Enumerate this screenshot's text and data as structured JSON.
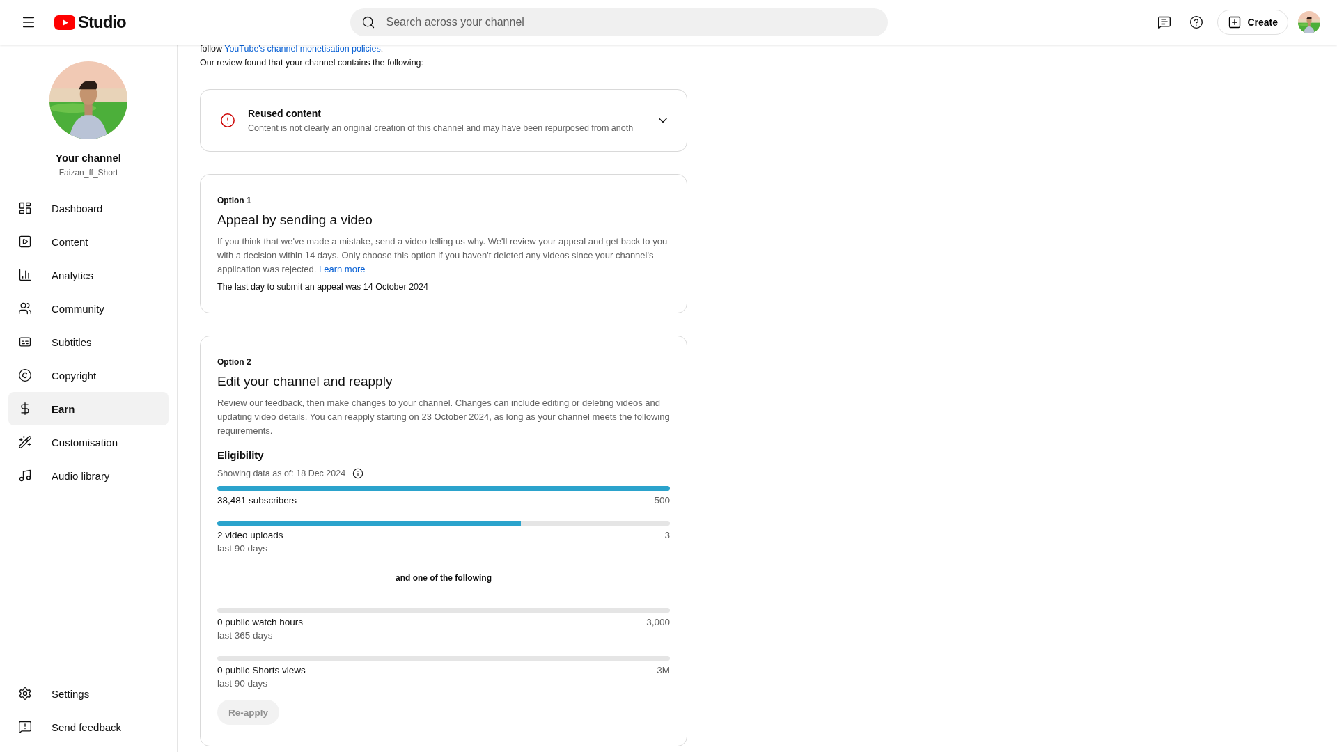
{
  "header": {
    "logo_text": "Studio",
    "search": {
      "placeholder": "Search across your channel"
    },
    "create_label": "Create"
  },
  "sidebar": {
    "channel_title": "Your channel",
    "channel_handle": "Faizan_ff_Short",
    "items": [
      {
        "label": "Dashboard",
        "selected": false
      },
      {
        "label": "Content",
        "selected": false
      },
      {
        "label": "Analytics",
        "selected": false
      },
      {
        "label": "Community",
        "selected": false
      },
      {
        "label": "Subtitles",
        "selected": false
      },
      {
        "label": "Copyright",
        "selected": false
      },
      {
        "label": "Earn",
        "selected": true
      },
      {
        "label": "Customisation",
        "selected": false
      },
      {
        "label": "Audio library",
        "selected": false
      }
    ],
    "footer_items": [
      {
        "label": "Settings"
      },
      {
        "label": "Send feedback"
      }
    ]
  },
  "intro": {
    "prefix": "follow",
    "link": "YouTube's channel monetisation policies",
    "suffix": ".",
    "review": "Our review found that your channel contains the following:"
  },
  "issue": {
    "title": "Reused content",
    "description": "Content is not clearly an original creation of this channel and may have been repurposed from anoth",
    "expanded": false
  },
  "option1": {
    "eyebrow": "Option 1",
    "title": "Appeal by sending a video",
    "body": "If you think that we've made a mistake, send a video telling us why. We'll review your appeal and get back to you with a decision within 14 days. Only choose this option if you haven't deleted any videos since your channel's application was rejected.",
    "link": "Learn more",
    "deadline": "The last day to submit an appeal was 14 October 2024"
  },
  "option2": {
    "eyebrow": "Option 2",
    "title": "Edit your channel and reapply",
    "body": "Review our feedback, then make changes to your channel. Changes can include editing or deleting videos and updating video details. You can reapply starting on 23 October 2024, as long as your channel meets the following requirements.",
    "eligibility_title": "Eligibility",
    "data_date": "Showing data as of: 18 Dec 2024",
    "requirements": [
      {
        "label": "38,481 subscribers",
        "target": "500",
        "level": 1
      },
      {
        "label": "2 video uploads",
        "sublabel": "last 90 days",
        "target": "3",
        "level": 0.67
      }
    ],
    "separator": "and one of the following",
    "alternatives": [
      {
        "label": "0 public watch hours",
        "sublabel": "last 365 days",
        "target": "3,000",
        "level": 0
      },
      {
        "label": "0 public Shorts views",
        "sublabel": "last 90 days",
        "target": "3M",
        "level": 0
      }
    ],
    "button": {
      "label": "Re-apply",
      "disabled": true
    }
  }
}
